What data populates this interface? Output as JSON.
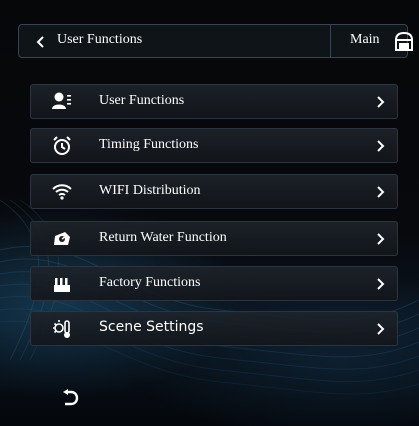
{
  "header": {
    "title": "User Functions",
    "main_label": "Main"
  },
  "menu": {
    "items": [
      {
        "label": "User Functions",
        "icon": "user-icon"
      },
      {
        "label": "Timing Functions",
        "icon": "alarm-clock-icon"
      },
      {
        "label": "WIFI Distribution",
        "icon": "wifi-icon"
      },
      {
        "label": "Return Water Function",
        "icon": "water-pump-icon"
      },
      {
        "label": "Factory Functions",
        "icon": "factory-icon"
      },
      {
        "label": "Scene Settings",
        "icon": "scene-icon"
      }
    ]
  },
  "colors": {
    "background": "#05070b",
    "border": "#2c343f",
    "text": "#ffffff"
  }
}
